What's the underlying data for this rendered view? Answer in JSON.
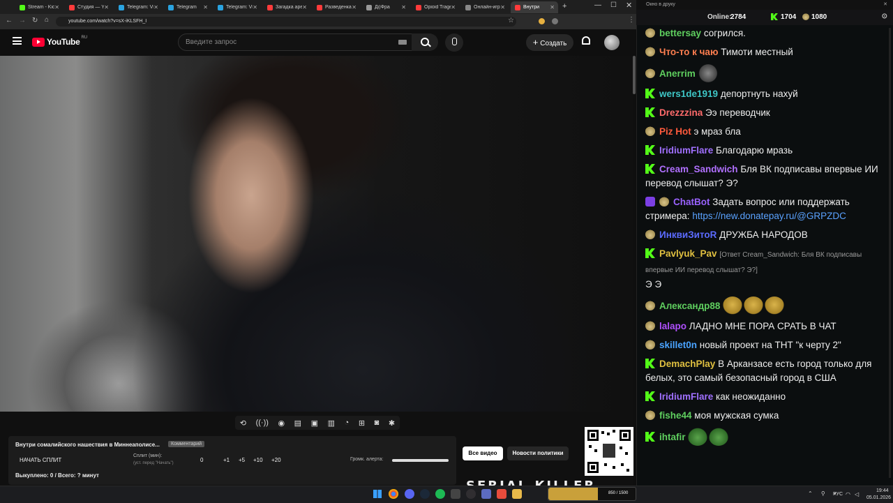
{
  "browser": {
    "tabs": [
      {
        "title": "Stream - Kick",
        "color": "#53fc18"
      },
      {
        "title": "Студия — YT",
        "color": "#ff3b3b"
      },
      {
        "title": "Telegram: Vi",
        "color": "#2aa3e0"
      },
      {
        "title": "Telegram",
        "color": "#2aa3e0"
      },
      {
        "title": "Telegram: Vi",
        "color": "#2aa3e0"
      },
      {
        "title": "Загадка аре",
        "color": "#ff3b3b"
      },
      {
        "title": "Разведенка",
        "color": "#ff3b3b"
      },
      {
        "title": "Дi)Фра",
        "color": "#999999"
      },
      {
        "title": "Opioid Trage",
        "color": "#ff3b3b"
      },
      {
        "title": "Онлайн-игр",
        "color": "#888888"
      },
      {
        "title": "Внутри",
        "color": "#ff3b3b"
      }
    ],
    "url": "youtube.com/watch?v=sX-iKLSFH_I"
  },
  "youtube": {
    "logo": "YouTube",
    "region": "RU",
    "search_placeholder": "Введите запрос",
    "create_label": "Создать"
  },
  "panel": {
    "video_title": "Внутри сомалийского нашествия в Миннеаполисе...",
    "title_tag": "Комментарий",
    "start_split": "НАЧАТЬ СПЛИТ",
    "split_label": "Сплит (мин):",
    "split_hint": "(уст. перед \"Начать\")",
    "split_value": "0",
    "steps": [
      "+1",
      "+5",
      "+10",
      "+20"
    ],
    "alert_volume_label": "Громк. алерта:",
    "alert_volume": 1.0,
    "bought": "Выкуплено: 0 / Всего: ? минут",
    "all_videos": "Все видео",
    "politics_news": "Новости политики",
    "overlay_text": "SERIAL KILLER"
  },
  "chat": {
    "window_title": "Окно в друку",
    "online_label": "Online:",
    "online_count": "2784",
    "kick_count": "1704",
    "potato_count": "1080",
    "messages": [
      {
        "badge": "potato",
        "name": "bettersay",
        "color": "#5fcf5f",
        "text": "согрился."
      },
      {
        "badge": "potato",
        "name": "Что-то к чаю",
        "color": "#ff7f50",
        "text": "Тимоти местный"
      },
      {
        "badge": "potato",
        "name": "Anerrim",
        "color": "#5fcf5f",
        "text": "",
        "emotes": [
          "cat"
        ]
      },
      {
        "badge": "kick",
        "name": "wers1de1919",
        "color": "#3ec6c6",
        "text": "депортнуть нахуй"
      },
      {
        "badge": "kick",
        "name": "Drezzzina",
        "color": "#ff6b6b",
        "text": "Ээ переводчик"
      },
      {
        "badge": "potato",
        "name": "Piz Hot",
        "color": "#ff5a3c",
        "text": "э мраз бла"
      },
      {
        "badge": "kick",
        "name": "IridiumFlare",
        "color": "#a070ff",
        "text": "Благодарю мразь"
      },
      {
        "badge": "kick",
        "name": "Cream_Sandwich",
        "color": "#b070ff",
        "text": "Бля ВК подписавы впервые ИИ перевод слышат? Э?"
      },
      {
        "badge": "chatbot",
        "name": "ChatBot",
        "color": "#9a62ff",
        "text": "Задать вопрос или поддержать стримера:",
        "link": "https://new.donatepay.ru/@GRPZDC"
      },
      {
        "badge": "potato",
        "name": "ИнквиЗитоR",
        "color": "#5b6bff",
        "text": "ДРУЖБА НАРОДОВ"
      },
      {
        "badge": "kick",
        "name": "Pavlyuk_Pav",
        "color": "#e0c040",
        "reply": "[Ответ Cream_Sandwich: Бля ВК подписавы впервые ИИ перевод слышат? Э?]",
        "text": "Э Э"
      },
      {
        "badge": "potato",
        "name": "Александр88",
        "color": "#5fcf5f",
        "text": "",
        "emotes": [
          "face",
          "face",
          "face"
        ]
      },
      {
        "badge": "potato",
        "name": "lalapo",
        "color": "#b050ff",
        "text": "ЛАДНО МНЕ ПОРА СРАТЬ В ЧАТ"
      },
      {
        "badge": "potato",
        "name": "skillet0n",
        "color": "#4aa3ff",
        "text": "новый проект на ТНТ \"к черту 2\""
      },
      {
        "badge": "kick",
        "name": "DemachPlay",
        "color": "#e0c040",
        "text": "В Арканзасе есть город только для белых, это самый безопасный город в США"
      },
      {
        "badge": "kick",
        "name": "IridiumFlare",
        "color": "#a070ff",
        "text": "как неожиданно"
      },
      {
        "badge": "potato",
        "name": "fishe44",
        "color": "#5fcf5f",
        "text": "моя мужская сумка"
      },
      {
        "badge": "kick",
        "name": "ihtafir",
        "color": "#5fcf5f",
        "text": "",
        "emotes": [
          "pepe",
          "pepe"
        ]
      }
    ]
  },
  "taskbar": {
    "lang": "РУС",
    "time": "19:44",
    "date": "05.01.2026",
    "widget": "850 / 1500"
  }
}
